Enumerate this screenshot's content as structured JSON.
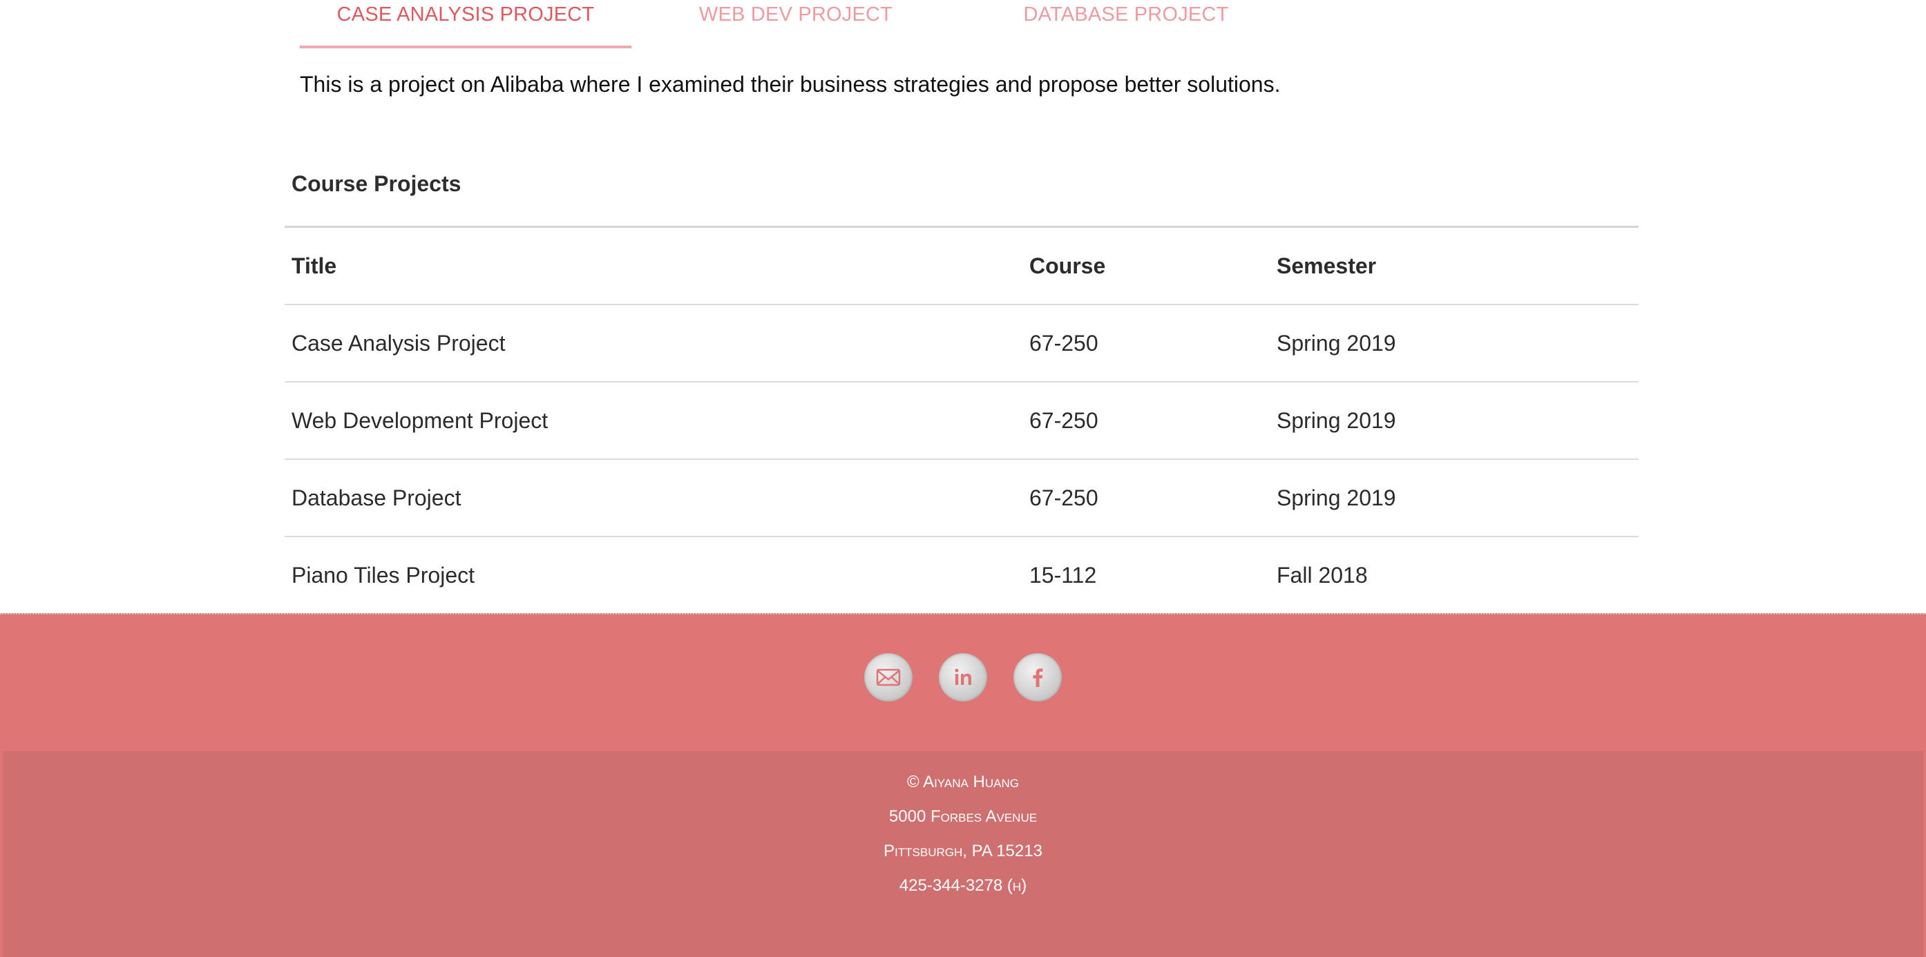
{
  "tabs": [
    {
      "label": "Case Analysis Project",
      "active": true
    },
    {
      "label": "Web Dev Project",
      "active": false
    },
    {
      "label": "Database Project",
      "active": false
    }
  ],
  "tab_content": "This is a project on Alibaba where I examined their business strategies and propose better solutions.",
  "course_table": {
    "caption": "Course Projects",
    "headers": [
      "Title",
      "Course",
      "Semester"
    ],
    "rows": [
      [
        "Case Analysis Project",
        "67-250",
        "Spring 2019"
      ],
      [
        "Web Development Project",
        "67-250",
        "Spring 2019"
      ],
      [
        "Database Project",
        "67-250",
        "Spring 2019"
      ],
      [
        "Piano Tiles Project",
        "15-112",
        "Fall 2018"
      ]
    ]
  },
  "footer": {
    "social_icons": [
      "email-icon",
      "linkedin-icon",
      "facebook-icon"
    ],
    "copyright": "© Aiyana Huang",
    "address_line1": "5000 Forbes Avenue",
    "address_line2": "Pittsburgh, PA 15213",
    "phone": "425-344-3278 (h)"
  },
  "colors": {
    "accent": "#e0585f",
    "tab_inactive": "#ee9aa0",
    "footer_bg": "#e07576",
    "footer_bottom_bg": "#d06f6f"
  }
}
